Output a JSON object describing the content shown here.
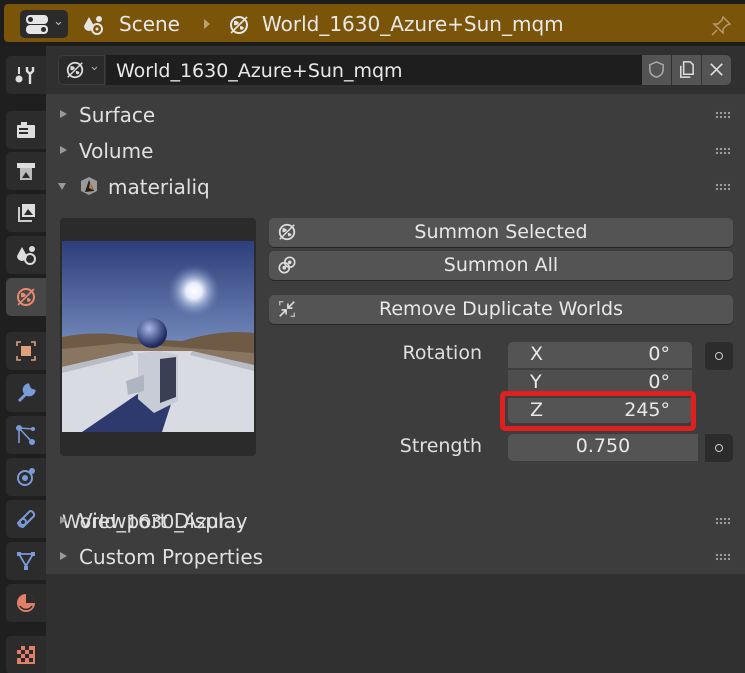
{
  "header": {
    "editor_type_icon": "properties-editor-icon",
    "breadcrumb": [
      {
        "icon": "scene-icon",
        "label": "Scene"
      },
      {
        "icon": "world-icon",
        "label": "World_1630_Azure+Sun_mqm"
      }
    ],
    "pin_icon": "pin-icon",
    "bar_color": "#7a5409"
  },
  "sidebar": {
    "tabs": [
      {
        "name": "tool",
        "icon": "tool-icon",
        "active": false
      },
      {
        "name": "render",
        "icon": "render-icon",
        "active": false
      },
      {
        "name": "output",
        "icon": "output-icon",
        "active": false
      },
      {
        "name": "view-layer",
        "icon": "view-layer-icon",
        "active": false
      },
      {
        "name": "scene",
        "icon": "scene-icon",
        "active": false
      },
      {
        "name": "world",
        "icon": "world-icon",
        "active": true
      },
      {
        "name": "object",
        "icon": "object-icon",
        "active": false
      },
      {
        "name": "modifiers",
        "icon": "wrench-icon",
        "active": false
      },
      {
        "name": "particles",
        "icon": "particles-icon",
        "active": false
      },
      {
        "name": "physics",
        "icon": "physics-icon",
        "active": false
      },
      {
        "name": "constraints",
        "icon": "constraints-icon",
        "active": false
      },
      {
        "name": "data",
        "icon": "data-icon",
        "active": false
      },
      {
        "name": "material",
        "icon": "material-icon",
        "active": false
      },
      {
        "name": "texture",
        "icon": "texture-icon",
        "active": false
      }
    ]
  },
  "datablock": {
    "name": "World_1630_Azure+Sun_mqm",
    "fake_user_icon": "shield-icon",
    "duplicate_icon": "duplicate-icon",
    "unlink_icon": "close-icon"
  },
  "panels": {
    "surface": "Surface",
    "volume": "Volume",
    "addon": "materialiq",
    "viewport_display": "Viewport Display",
    "custom_properties": "Custom Properties"
  },
  "addon": {
    "preview_label": "World_1630_Azur...",
    "buttons": {
      "summon_selected": "Summon Selected",
      "summon_all": "Summon All",
      "remove_duplicates": "Remove Duplicate Worlds"
    },
    "rotation": {
      "label": "Rotation",
      "x_label": "X",
      "x_value": "0°",
      "y_label": "Y",
      "y_value": "0°",
      "z_label": "Z",
      "z_value": "245°"
    },
    "strength": {
      "label": "Strength",
      "value": "0.750"
    },
    "highlight_color": "#e11f1f"
  }
}
